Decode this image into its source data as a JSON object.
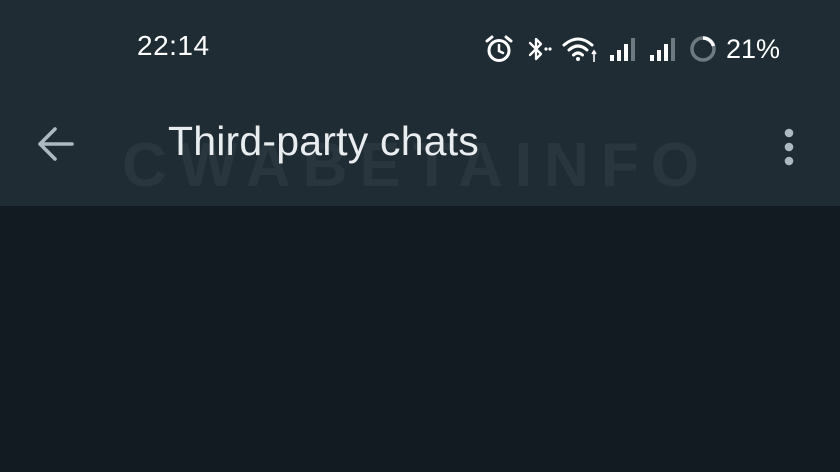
{
  "status_bar": {
    "time": "22:14",
    "battery_percent": "21%",
    "icons": [
      "alarm-icon",
      "bluetooth-icon",
      "wifi-icon",
      "signal-icon",
      "signal-icon",
      "battery-icon"
    ]
  },
  "app_bar": {
    "title": "Third-party chats",
    "back_icon": "arrow-back-icon",
    "menu_icon": "more-vert-icon"
  },
  "watermark": "CWABETAINFO",
  "colors": {
    "app_bar_bg": "#1f2c34",
    "content_bg": "#121b22",
    "title_text": "#e9edef",
    "icon": "#aebac1"
  }
}
